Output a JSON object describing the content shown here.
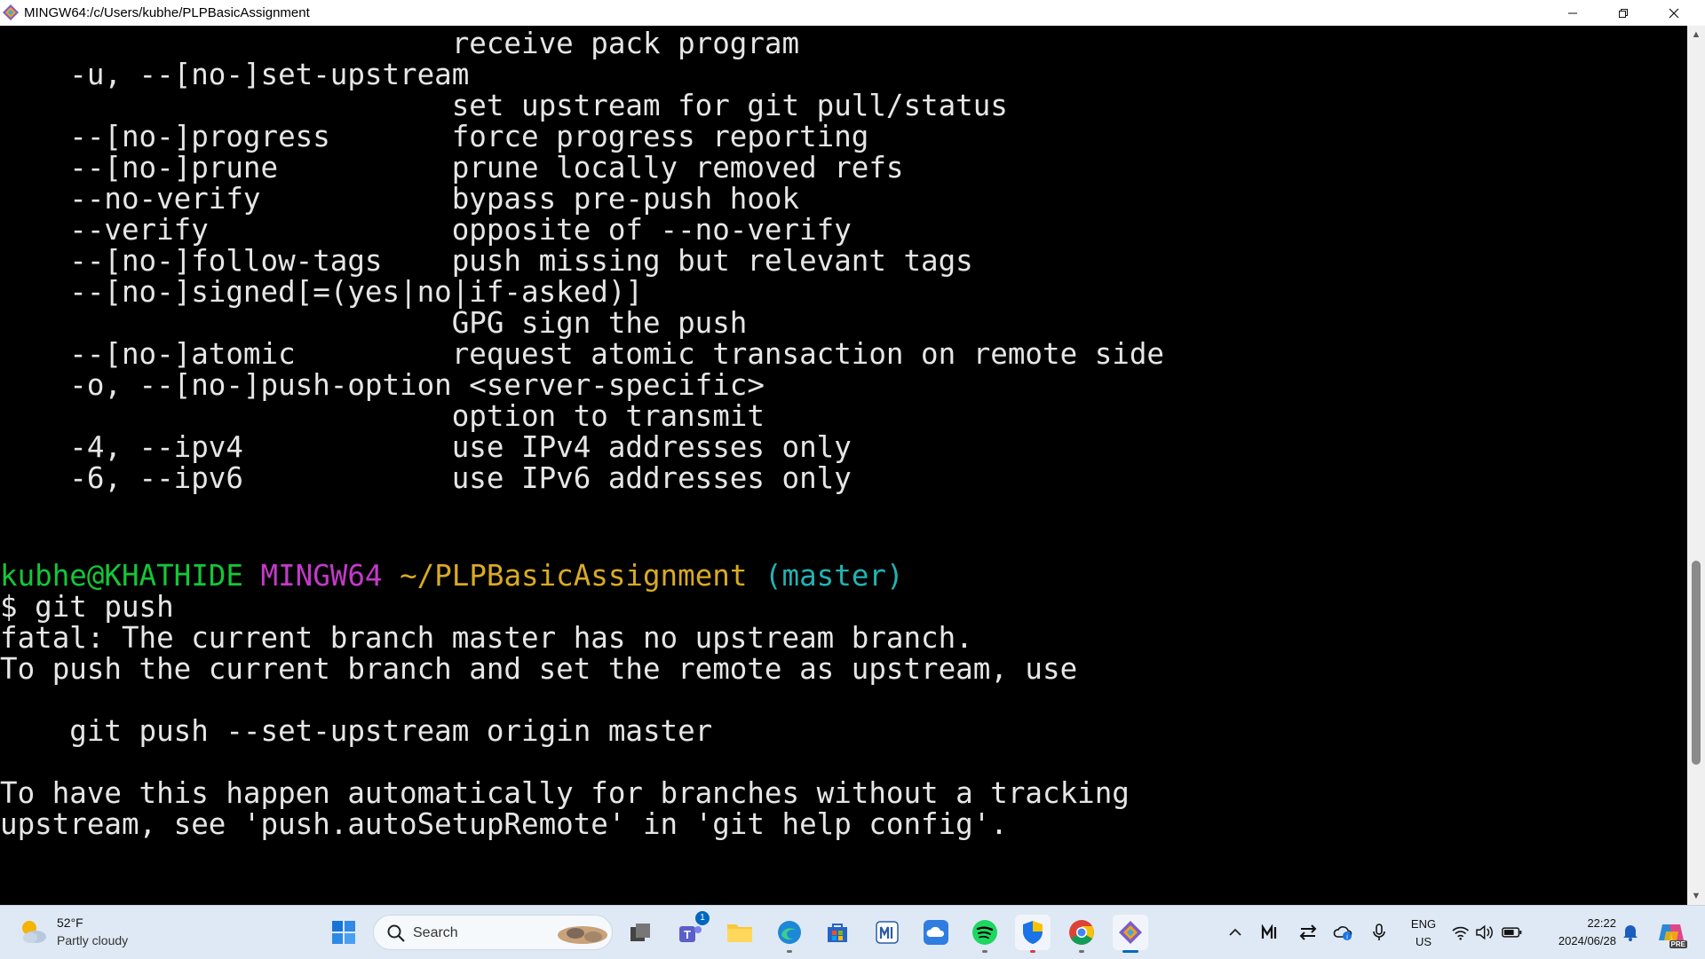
{
  "window": {
    "title": "MINGW64:/c/Users/kubhe/PLPBasicAssignment",
    "minimize_icon": "minimize-icon",
    "maximize_icon": "restore-icon",
    "close_icon": "close-icon"
  },
  "terminal": {
    "help_lines": [
      "                          receive pack program",
      "    -u, --[no-]set-upstream",
      "                          set upstream for git pull/status",
      "    --[no-]progress       force progress reporting",
      "    --[no-]prune          prune locally removed refs",
      "    --no-verify           bypass pre-push hook",
      "    --verify              opposite of --no-verify",
      "    --[no-]follow-tags    push missing but relevant tags",
      "    --[no-]signed[=(yes|no|if-asked)]",
      "                          GPG sign the push",
      "    --[no-]atomic         request atomic transaction on remote side",
      "    -o, --[no-]push-option <server-specific>",
      "                          option to transmit",
      "    -4, --ipv4            use IPv4 addresses only",
      "    -6, --ipv6            use IPv6 addresses only"
    ],
    "prompt": {
      "user_host": "kubhe@KHATHIDE",
      "env": "MINGW64",
      "path": "~/PLPBasicAssignment",
      "branch": "(master)"
    },
    "command": "$ git push",
    "output_lines": [
      "fatal: The current branch master has no upstream branch.",
      "To push the current branch and set the remote as upstream, use",
      "",
      "    git push --set-upstream origin master",
      "",
      "To have this happen automatically for branches without a tracking",
      "upstream, see 'push.autoSetupRemote' in 'git help config'."
    ],
    "colors": {
      "user_host": "#13c738",
      "env": "#c33ac8",
      "path": "#d9ab23",
      "branch": "#22b3b3",
      "text": "#e6e6e6",
      "background": "#000000"
    }
  },
  "taskbar": {
    "weather": {
      "temp": "52°F",
      "desc": "Partly cloudy",
      "icon": "partly-cloudy-icon"
    },
    "search": {
      "label": "Search",
      "icon": "search-icon"
    },
    "apps": [
      {
        "name": "start-button",
        "icon": "windows-logo-icon"
      },
      {
        "name": "task-view",
        "icon": "task-view-icon"
      },
      {
        "name": "teams",
        "icon": "teams-icon",
        "badge": "1"
      },
      {
        "name": "file-explorer",
        "icon": "folder-icon"
      },
      {
        "name": "edge",
        "icon": "edge-icon"
      },
      {
        "name": "microsoft-store",
        "icon": "store-icon"
      },
      {
        "name": "app-ml",
        "icon": "ml-app-icon"
      },
      {
        "name": "onedrive-app",
        "icon": "cloud-app-icon"
      },
      {
        "name": "spotify",
        "icon": "spotify-icon"
      },
      {
        "name": "security",
        "icon": "shield-icon"
      },
      {
        "name": "chrome",
        "icon": "chrome-icon"
      },
      {
        "name": "git-bash",
        "icon": "git-icon"
      }
    ],
    "tray": {
      "lang_top": "ENG",
      "lang_bottom": "US",
      "time": "22:22",
      "date": "2024/06/28"
    },
    "copilot_badge": "PRE"
  }
}
